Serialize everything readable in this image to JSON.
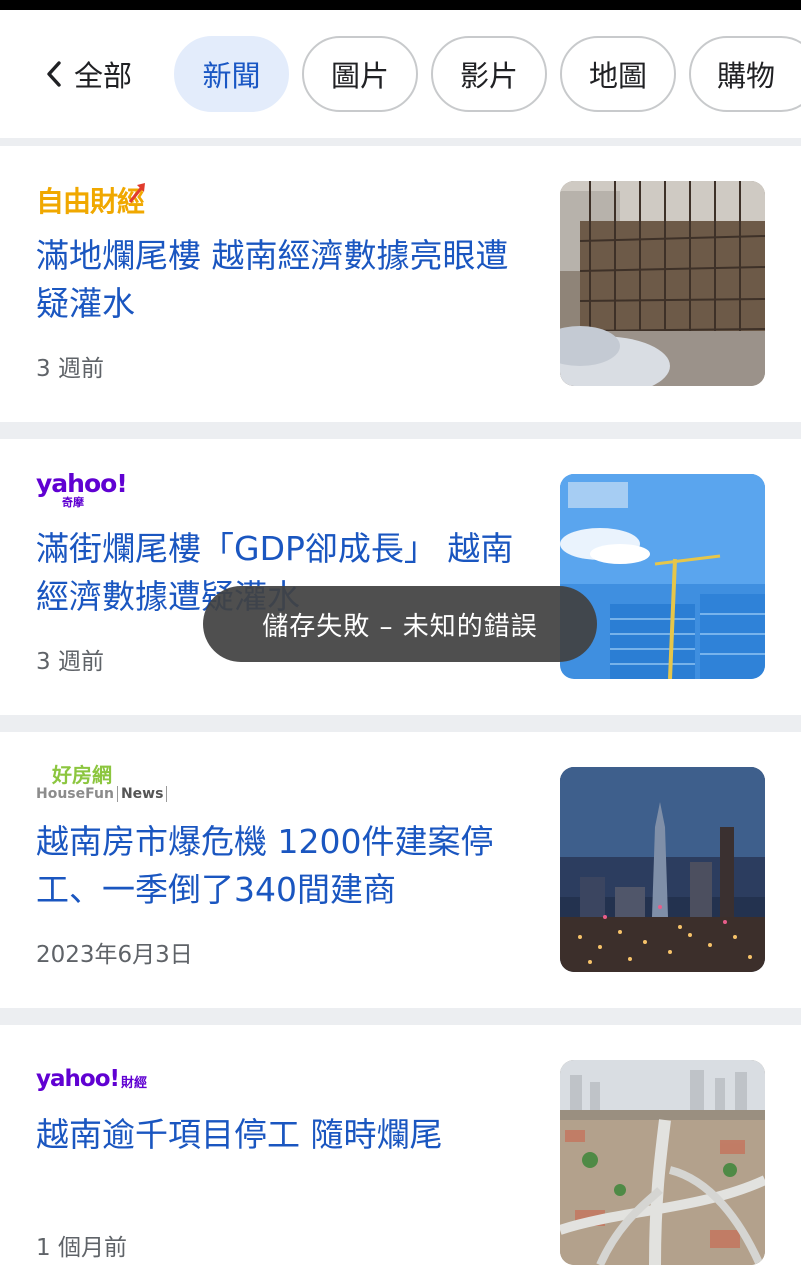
{
  "tabs": {
    "back_label": "全部",
    "items": [
      {
        "label": "新聞",
        "active": true
      },
      {
        "label": "圖片",
        "active": false
      },
      {
        "label": "影片",
        "active": false
      },
      {
        "label": "地圖",
        "active": false
      },
      {
        "label": "購物",
        "active": false
      }
    ]
  },
  "results": [
    {
      "source": "自由財經",
      "title": "滿地爛尾樓 越南經濟數據亮眼遭疑灌水",
      "time": "3 週前"
    },
    {
      "source": "yahoo!",
      "source_sub": "奇摩",
      "title": "滿街爛尾樓「GDP卻成長」 越南經濟數據遭疑灌水",
      "time": "3 週前"
    },
    {
      "source": "好房網",
      "source_sub": "HouseFun",
      "source_sub2": "News",
      "title": "越南房市爆危機 1200件建案停工、一季倒了340間建商",
      "time": "2023年6月3日"
    },
    {
      "source": "yahoo!",
      "source_sub": "財經",
      "title": "越南逾千項目停工 隨時爛尾",
      "time": "1 個月前"
    }
  ],
  "toast": {
    "message": "儲存失敗 – 未知的錯誤"
  },
  "colors": {
    "link_blue": "#1a56c0",
    "active_chip_bg": "#e3ecfb",
    "yahoo_purple": "#6001d2",
    "toast_bg": "#424242"
  },
  "icons": {
    "back": "chevron-left-icon"
  }
}
